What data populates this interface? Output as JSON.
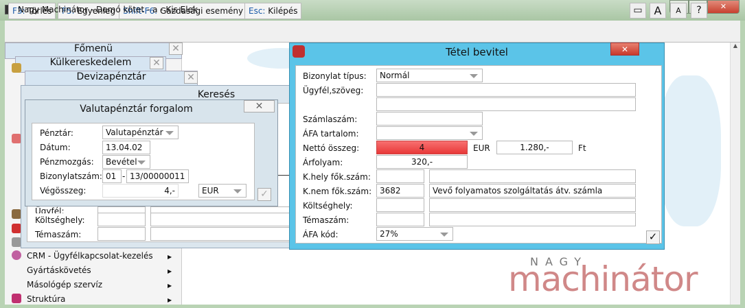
{
  "window": {
    "title": "Nagy Machinátor - Demó kötet - a - Kis Elek",
    "min": "▁",
    "max": "▢",
    "close": "✕"
  },
  "toolbar": {
    "buttons": [
      {
        "key": "F3:",
        "label": " Törlés"
      },
      {
        "key": "F5:",
        "label": " Egyenleg"
      },
      {
        "key": "Shift-F6:",
        "label": " Gazdasági esemény"
      },
      {
        "key": "Esc:",
        "label": " Kilépés"
      }
    ],
    "icons": [
      "▭",
      "A",
      "A",
      "?"
    ]
  },
  "panels": {
    "fomenu": "Főmenü",
    "kulker": "Külkereskedelem",
    "deviza": "Devizapénztár",
    "kereses": "Keresés",
    "close": "✕"
  },
  "menu": {
    "items": [
      {
        "label": "CRM - Ügyfélkapcsolat-kezelés"
      },
      {
        "label": "Gyártáskövetés"
      },
      {
        "label": "Másológép szervíz"
      },
      {
        "label": "Struktúra"
      }
    ],
    "arrow": "▶"
  },
  "kereses": {
    "ugyfel": "Ügyfél:",
    "koltseghely": "Költséghely:",
    "temaszam": "Témaszám:"
  },
  "valuta": {
    "title": "Valutapénztár forgalom",
    "close": "✕",
    "penztar_label": "Pénztár:",
    "penztar": "Valutapénztár",
    "datum_label": "Dátum:",
    "datum": "13.04.02",
    "penzmozgas_label": "Pénzmozgás:",
    "penzmozgas": "Bevétel",
    "bizonylat_label": "Bizonylatszám:",
    "biz_prefix": "01",
    "biz_sep": "-",
    "biz_num": "13/00000011",
    "vegosszeg_label": "Végösszeg:",
    "vegosszeg": "4,-",
    "currency": "EUR",
    "ok": "✓"
  },
  "tetel": {
    "title": "Tétel bevitel",
    "close": "✕",
    "bizonylat_tipus_label": "Bizonylat típus:",
    "bizonylat_tipus": "Normál",
    "ugyfel_label": "Ügyfél,szöveg:",
    "ugyfel1": "",
    "ugyfel2": "",
    "szamlaszam_label": "Számlaszám:",
    "szamlaszam": "",
    "afa_tartalom_label": "ÁFA tartalom:",
    "afa_tartalom": "",
    "netto_label": "Nettó összeg:",
    "netto": "4",
    "netto_currency": "EUR",
    "netto_ft": "1.280,-",
    "ft": "Ft",
    "arfolyam_label": "Árfolyam:",
    "arfolyam": "320,-",
    "khely_label": "K.hely fők.szám:",
    "khely_num": "",
    "khely_name": "",
    "knem_label": "K.nem fők.szám:",
    "knem_num": "3682",
    "knem_name": "Vevő folyamatos szolgáltatás átv. számla",
    "koltseghely_label": "Költséghely:",
    "temaszam_label": "Témaszám:",
    "afa_kod_label": "ÁFA kód:",
    "afa_kod": "27%",
    "ok": "✓"
  },
  "logo": {
    "top": "NAGY",
    "main": "machinátor"
  },
  "colors": {
    "accent_blue": "#5bc4e8",
    "error_red": "#f04848",
    "close_red": "#d9453a"
  }
}
